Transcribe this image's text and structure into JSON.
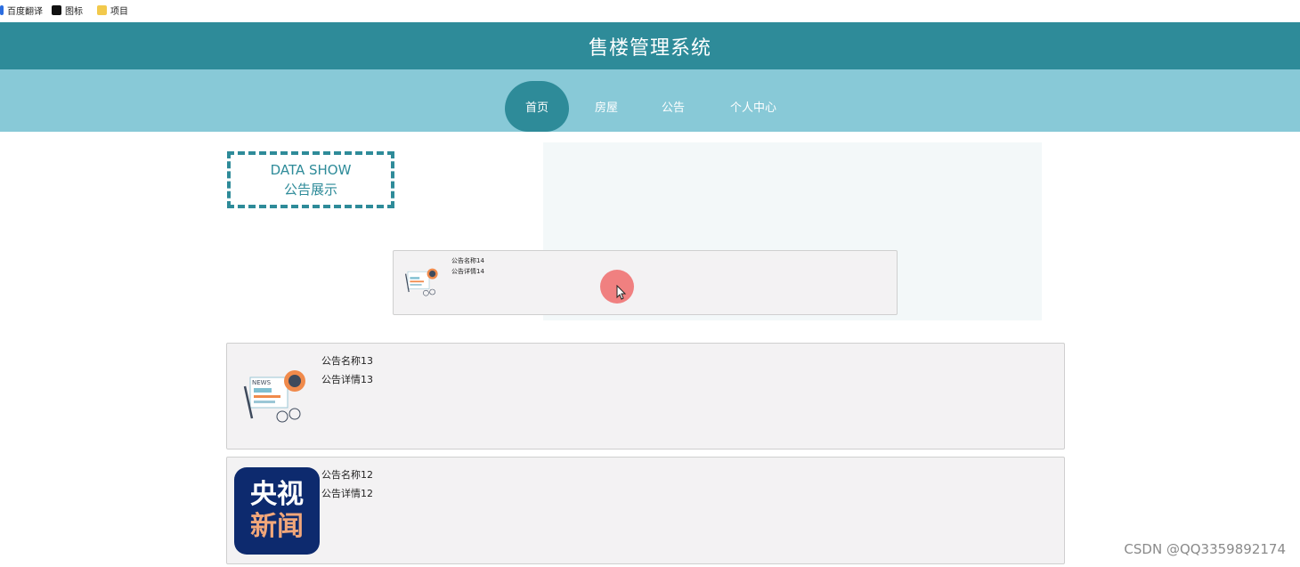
{
  "bookmarks": [
    {
      "label": "百度翻译",
      "icon": "translate-icon"
    },
    {
      "label": "图标",
      "icon": "icons-site-icon"
    },
    {
      "label": "项目",
      "icon": "folder-icon"
    }
  ],
  "header": {
    "title": "售楼管理系统"
  },
  "nav": {
    "items": [
      {
        "label": "首页",
        "active": true
      },
      {
        "label": "房屋",
        "active": false
      },
      {
        "label": "公告",
        "active": false
      },
      {
        "label": "个人中心",
        "active": false
      }
    ]
  },
  "section": {
    "line1": "DATA SHOW",
    "line2": "公告展示"
  },
  "notices": [
    {
      "name": "公告名称14",
      "detail": "公告详情14",
      "image": "news-illustration-icon"
    },
    {
      "name": "公告名称13",
      "detail": "公告详情13",
      "image": "news-illustration-icon"
    },
    {
      "name": "公告名称12",
      "detail": "公告详情12",
      "image": "cctv-news-logo"
    }
  ],
  "logo_cctv": {
    "line1": "央视",
    "line2": "新闻"
  },
  "watermark": "CSDN @QQ3359892174",
  "colors": {
    "header_bg": "#2e8b99",
    "nav_bg": "#88c9d7",
    "accent": "#2e8b99",
    "card_bg": "#f3f2f3"
  }
}
